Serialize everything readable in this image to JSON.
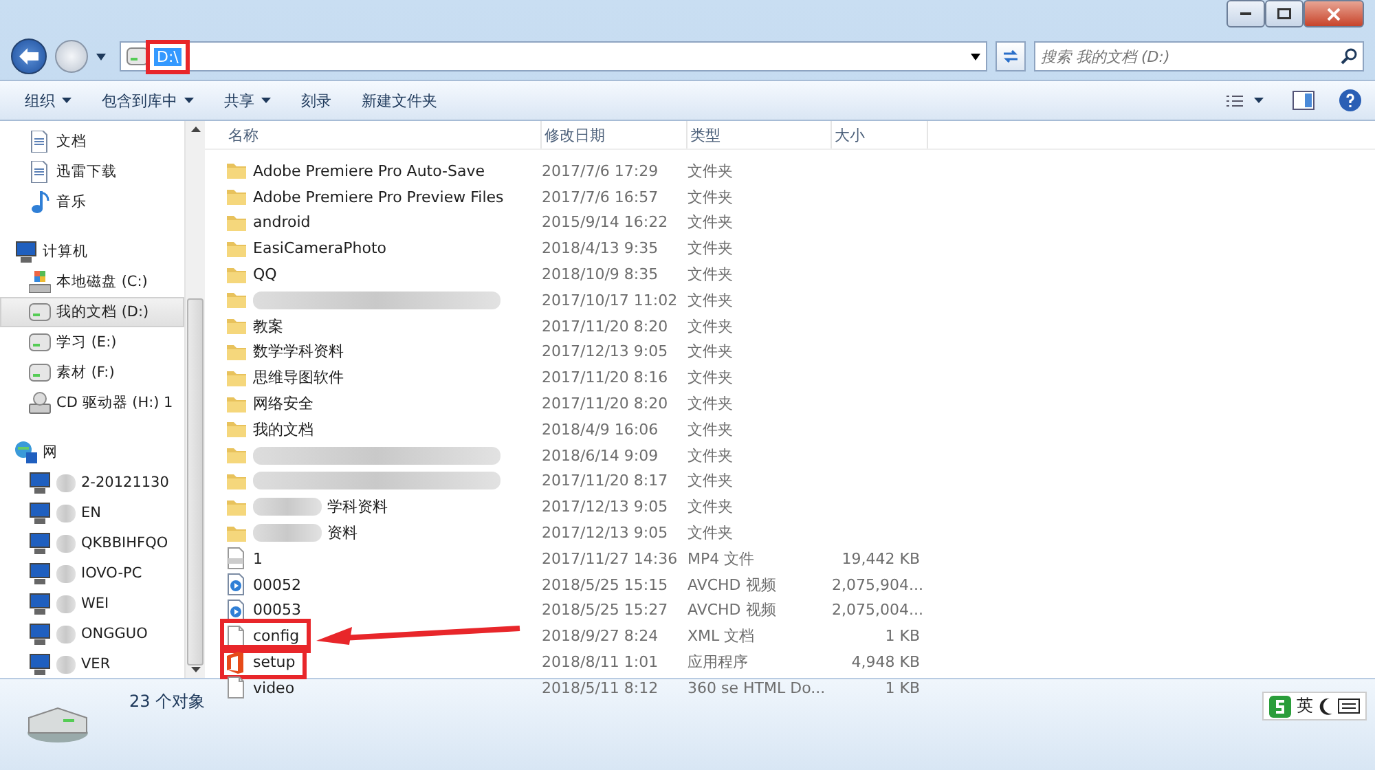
{
  "address": {
    "value": "D:\\",
    "highlighted": true
  },
  "search": {
    "placeholder": "搜索 我的文档 (D:)"
  },
  "toolbar": [
    {
      "label": "组织",
      "dropdown": true
    },
    {
      "label": "包含到库中",
      "dropdown": true
    },
    {
      "label": "共享",
      "dropdown": true
    },
    {
      "label": "刻录",
      "dropdown": false
    },
    {
      "label": "新建文件夹",
      "dropdown": false
    }
  ],
  "sidebar": {
    "groups": [
      {
        "children": [
          {
            "label": "文档",
            "kind": "doc",
            "selected": false
          },
          {
            "label": "迅雷下载",
            "kind": "doc",
            "selected": false
          },
          {
            "label": "音乐",
            "kind": "music",
            "selected": false
          }
        ]
      },
      {
        "label": "计算机",
        "kind": "computer",
        "children": [
          {
            "label": "本地磁盘 (C:)",
            "kind": "sysdrive",
            "selected": false
          },
          {
            "label": "我的文档 (D:)",
            "kind": "drive",
            "selected": true
          },
          {
            "label": "学习 (E:)",
            "kind": "drive",
            "selected": false
          },
          {
            "label": "素材 (F:)",
            "kind": "drive",
            "selected": false
          },
          {
            "label": "CD 驱动器 (H:) 1",
            "kind": "cd",
            "selected": false
          }
        ]
      },
      {
        "label": "网",
        "kind": "network",
        "children": [
          {
            "label": "2-20121130",
            "kind": "computer",
            "selected": false,
            "blurred": true
          },
          {
            "label": "EN",
            "kind": "computer",
            "selected": false,
            "blurred": true
          },
          {
            "label": "QKBBIHFQO",
            "kind": "computer",
            "selected": false,
            "blurred": true
          },
          {
            "label": "IOVO-PC",
            "kind": "computer",
            "selected": false,
            "blurred": true
          },
          {
            "label": "WEI",
            "kind": "computer",
            "selected": false,
            "blurred": true
          },
          {
            "label": "ONGGUO",
            "kind": "computer",
            "selected": false,
            "blurred": true
          },
          {
            "label": "VER",
            "kind": "computer",
            "selected": false,
            "blurred": true
          }
        ]
      }
    ]
  },
  "table": {
    "columns": [
      "名称",
      "修改日期",
      "类型",
      "大小"
    ],
    "rows": [
      {
        "kind": "folder",
        "name": "Adobe Premiere Pro Auto-Save",
        "date": "2017/7/6 17:29",
        "type": "文件夹"
      },
      {
        "kind": "folder",
        "name": "Adobe Premiere Pro Preview Files",
        "date": "2017/7/6 16:57",
        "type": "文件夹"
      },
      {
        "kind": "folder",
        "name": "android",
        "date": "2015/9/14 16:22",
        "type": "文件夹"
      },
      {
        "kind": "folder",
        "name": "EasiCameraPhoto",
        "date": "2018/4/13 9:35",
        "type": "文件夹"
      },
      {
        "kind": "folder",
        "name": "QQ",
        "date": "2018/10/9 8:35",
        "type": "文件夹"
      },
      {
        "kind": "folder",
        "blurred": true,
        "date": "2017/10/17 11:02",
        "type": "文件夹"
      },
      {
        "kind": "folder",
        "name": "教案",
        "date": "2017/11/20 8:20",
        "type": "文件夹"
      },
      {
        "kind": "folder",
        "name": "数学学科资料",
        "date": "2017/12/13 9:05",
        "type": "文件夹"
      },
      {
        "kind": "folder",
        "name": "思维导图软件",
        "date": "2017/11/20 8:16",
        "type": "文件夹"
      },
      {
        "kind": "folder",
        "name": "网络安全",
        "date": "2017/11/20 8:20",
        "type": "文件夹"
      },
      {
        "kind": "folder",
        "name": "我的文档",
        "date": "2018/4/9 16:06",
        "type": "文件夹"
      },
      {
        "kind": "folder",
        "blurred": true,
        "date": "2018/6/14 9:09",
        "type": "文件夹"
      },
      {
        "kind": "folder",
        "blurred": true,
        "date": "2017/11/20 8:17",
        "type": "文件夹"
      },
      {
        "kind": "folder",
        "blurred": true,
        "name": "学科资料",
        "date": "2017/12/13 9:05",
        "type": "文件夹"
      },
      {
        "kind": "folder",
        "blurred": true,
        "name": "资料",
        "date": "2017/12/13 9:05",
        "type": "文件夹"
      },
      {
        "kind": "mp4",
        "name": "1",
        "date": "2017/11/27 14:36",
        "type": "MP4 文件",
        "size": "19,442 KB"
      },
      {
        "kind": "video",
        "name": "00052",
        "date": "2018/5/25 15:15",
        "type": "AVCHD 视频",
        "size": "2,075,904..."
      },
      {
        "kind": "video",
        "name": "00053",
        "date": "2018/5/25 15:27",
        "type": "AVCHD 视频",
        "size": "2,075,004..."
      },
      {
        "kind": "file",
        "name": "config",
        "date": "2018/9/27 8:24",
        "type": "XML 文档",
        "size": "1 KB",
        "highlighted": true,
        "arrow": true
      },
      {
        "kind": "office",
        "name": "setup",
        "date": "2018/8/11 1:01",
        "type": "应用程序",
        "size": "4,948 KB",
        "highlighted": true
      },
      {
        "kind": "file",
        "name": "video",
        "date": "2018/5/11 8:12",
        "type": "360 se HTML Do...",
        "size": "1 KB"
      }
    ]
  },
  "status_bar": {
    "count": "23 个对象"
  },
  "ime": {
    "label": "英"
  }
}
